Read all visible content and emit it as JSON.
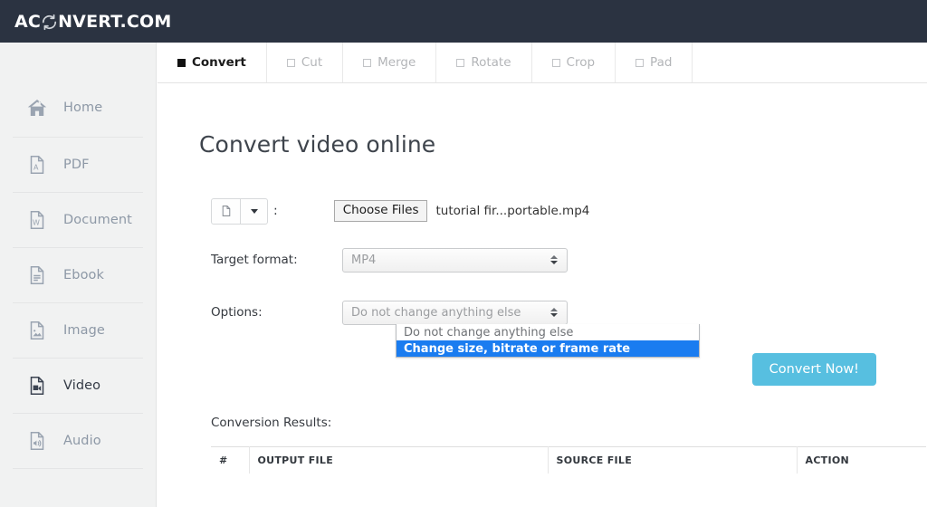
{
  "header": {
    "logo_prefix": "AC",
    "logo_icon": "refresh-cycle-icon",
    "logo_suffix": "NVERT.COM"
  },
  "sidebar": {
    "items": [
      {
        "label": "Home",
        "icon": "home-icon",
        "active": false
      },
      {
        "label": "PDF",
        "icon": "pdf-file-icon",
        "active": false
      },
      {
        "label": "Document",
        "icon": "word-document-icon",
        "active": false
      },
      {
        "label": "Ebook",
        "icon": "ebook-file-icon",
        "active": false
      },
      {
        "label": "Image",
        "icon": "image-file-icon",
        "active": false
      },
      {
        "label": "Video",
        "icon": "video-file-icon",
        "active": true
      },
      {
        "label": "Audio",
        "icon": "audio-file-icon",
        "active": false
      }
    ]
  },
  "tabs": [
    {
      "label": "Convert",
      "active": true
    },
    {
      "label": "Cut",
      "active": false
    },
    {
      "label": "Merge",
      "active": false
    },
    {
      "label": "Rotate",
      "active": false
    },
    {
      "label": "Crop",
      "active": false
    },
    {
      "label": "Pad",
      "active": false
    }
  ],
  "main": {
    "title": "Convert video online",
    "file_row": {
      "type_icon": "document-file-icon",
      "caret_icon": "caret-down-icon",
      "separator": ":",
      "choose_files_label": "Choose Files",
      "file_name": "tutorial fir...portable.mp4"
    },
    "target_format": {
      "label": "Target format:",
      "value": "MP4"
    },
    "options": {
      "label": "Options:",
      "value": "Do not change anything else",
      "dropdown_open": true,
      "choices": [
        {
          "label": "Do not change anything else",
          "highlighted": false
        },
        {
          "label": "Change size, bitrate or frame rate",
          "highlighted": true
        }
      ]
    },
    "convert_button": "Convert Now!",
    "results": {
      "label": "Conversion Results:",
      "columns": [
        "#",
        "OUTPUT FILE",
        "SOURCE FILE",
        "ACTION"
      ]
    }
  },
  "colors": {
    "topbar": "#2b3341",
    "sidebar": "#f1f2f2",
    "accent_button": "#57bfe0",
    "dropdown_highlight": "#1a7cf0"
  }
}
